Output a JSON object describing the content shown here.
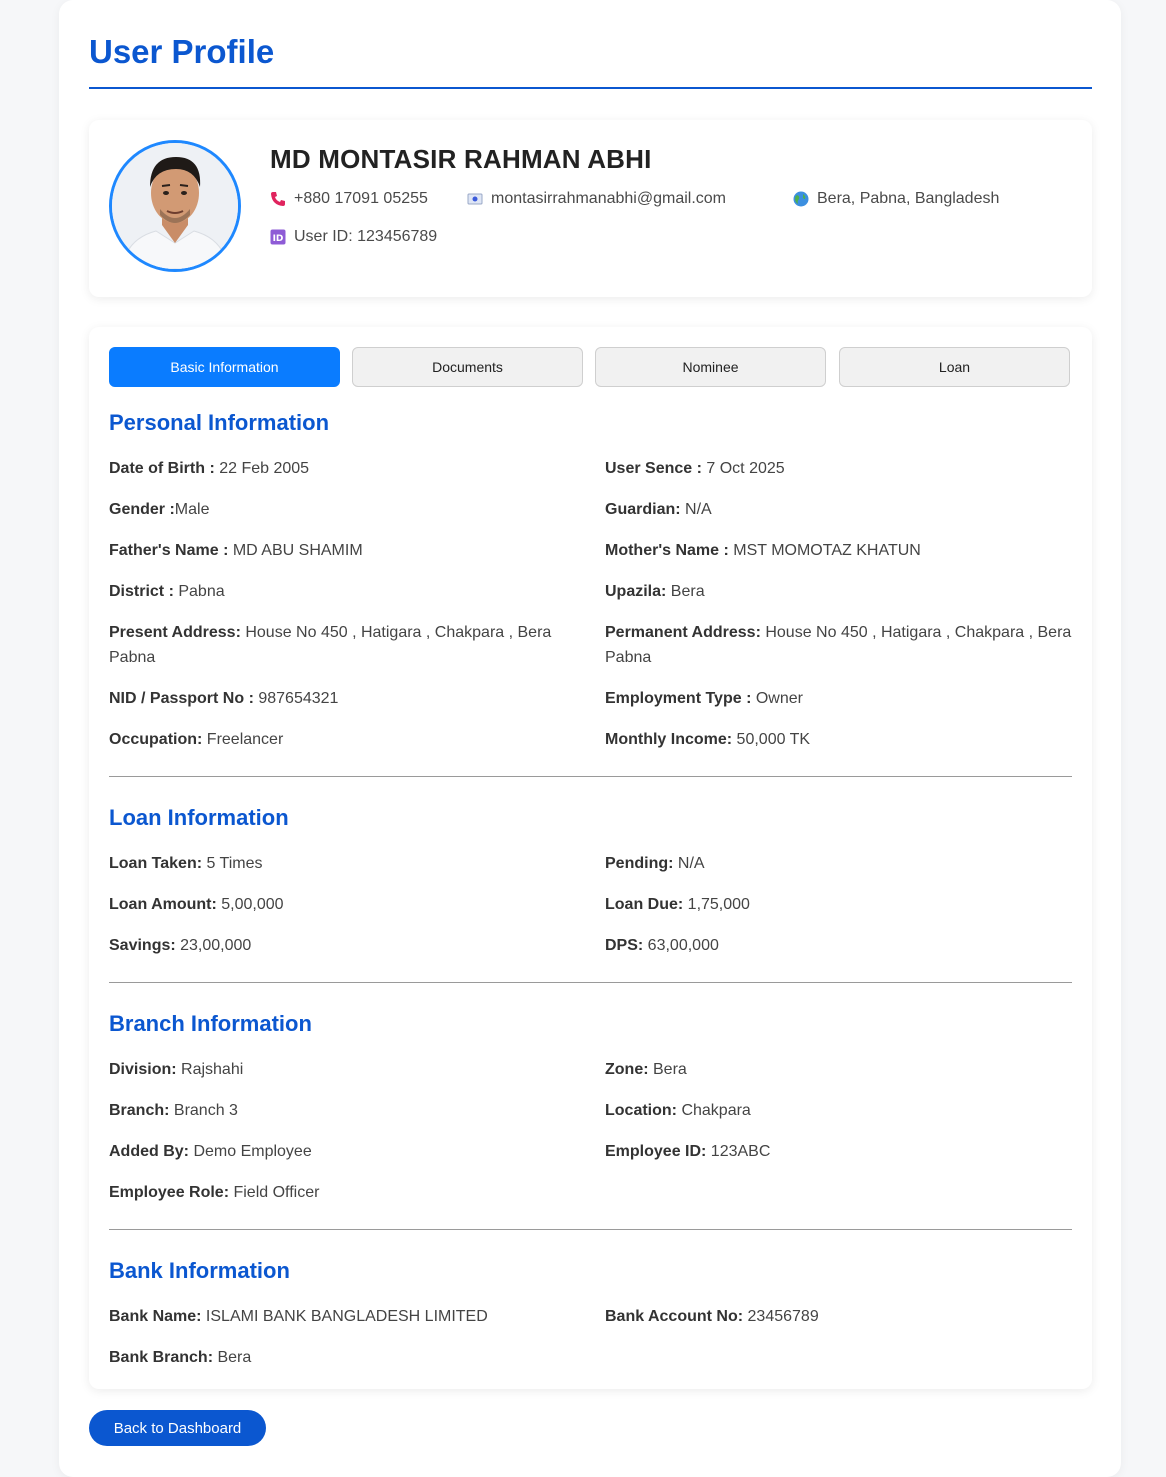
{
  "page": {
    "title": "User Profile"
  },
  "profile": {
    "name": "MD MONTASIR RAHMAN ABHI",
    "phone": "+880 17091 05255",
    "email": "montasirrahmanabhi@gmail.com",
    "location": "Bera, Pabna, Bangladesh",
    "user_id": "User ID: 123456789",
    "icons": {
      "phone": "phone-icon",
      "email": "email-icon",
      "location": "globe-icon",
      "id": "id-badge-icon"
    }
  },
  "tabs": [
    {
      "label": "Basic Information",
      "active": true
    },
    {
      "label": "Documents",
      "active": false
    },
    {
      "label": "Nominee",
      "active": false
    },
    {
      "label": "Loan",
      "active": false
    }
  ],
  "personal": {
    "title": "Personal Information",
    "dob": {
      "label": "Date of Birth :",
      "value": " 22 Feb 2005"
    },
    "user_since": {
      "label": "User Sence :",
      "value": " 7 Oct 2025"
    },
    "gender": {
      "label": "Gender :",
      "value": "Male"
    },
    "guardian": {
      "label": "Guardian:",
      "value": " N/A"
    },
    "father": {
      "label": "Father's Name :",
      "value": " MD ABU SHAMIM"
    },
    "mother": {
      "label": "Mother's Name :",
      "value": " MST MOMOTAZ KHATUN"
    },
    "district": {
      "label": "District :",
      "value": " Pabna"
    },
    "upazila": {
      "label": "Upazila:",
      "value": " Bera"
    },
    "present_address": {
      "label": "Present Address:",
      "value": " House No 450 , Hatigara , Chakpara , Bera Pabna"
    },
    "permanent_address": {
      "label": "Permanent Address:",
      "value": " House No 450 , Hatigara , Chakpara , Bera Pabna"
    },
    "nid": {
      "label": "NID / Passport No :",
      "value": " 987654321"
    },
    "employment_type": {
      "label": "Employment Type :",
      "value": " Owner"
    },
    "occupation": {
      "label": "Occupation:",
      "value": " Freelancer"
    },
    "monthly_income": {
      "label": "Monthly Income:",
      "value": " 50,000 TK"
    }
  },
  "loan": {
    "title": "Loan Information",
    "taken": {
      "label": "Loan Taken:",
      "value": " 5 Times"
    },
    "pending": {
      "label": "Pending:",
      "value": " N/A"
    },
    "amount": {
      "label": "Loan Amount:",
      "value": " 5,00,000"
    },
    "due": {
      "label": "Loan Due:",
      "value": " 1,75,000"
    },
    "savings": {
      "label": "Savings:",
      "value": " 23,00,000"
    },
    "dps": {
      "label": "DPS:",
      "value": " 63,00,000"
    }
  },
  "branch": {
    "title": "Branch Information",
    "division": {
      "label": "Division:",
      "value": " Rajshahi"
    },
    "zone": {
      "label": "Zone:",
      "value": " Bera"
    },
    "branch": {
      "label": "Branch:",
      "value": " Branch 3"
    },
    "location": {
      "label": "Location:",
      "value": " Chakpara"
    },
    "added_by": {
      "label": "Added By:",
      "value": " Demo Employee"
    },
    "employee_id": {
      "label": "Employee ID:",
      "value": " 123ABC"
    },
    "employee_role": {
      "label": "Employee Role:",
      "value": " Field Officer"
    }
  },
  "bank": {
    "title": "Bank Information",
    "name": {
      "label": "Bank Name:",
      "value": " ISLAMI BANK BANGLADESH LIMITED"
    },
    "account": {
      "label": "Bank Account No:",
      "value": " 23456789"
    },
    "branch": {
      "label": "Bank Branch:",
      "value": " Bera"
    }
  },
  "actions": {
    "back_label": "Back to Dashboard"
  },
  "colors": {
    "accent": "#0b57d0",
    "tab_active": "#0a7cff"
  }
}
